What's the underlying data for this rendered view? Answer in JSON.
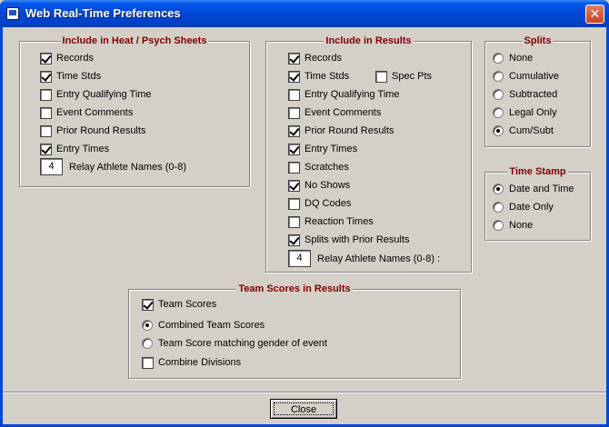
{
  "window": {
    "title": "Web Real-Time Preferences"
  },
  "heat_psych": {
    "title": "Include in Heat / Psych Sheets",
    "items": [
      {
        "label": "Records",
        "checked": true
      },
      {
        "label": "Time Stds",
        "checked": true
      },
      {
        "label": "Entry Qualifying Time",
        "checked": false
      },
      {
        "label": "Event Comments",
        "checked": false
      },
      {
        "label": "Prior Round Results",
        "checked": false
      },
      {
        "label": "Entry Times",
        "checked": true
      }
    ],
    "relay_value": "4",
    "relay_label": "Relay Athlete Names (0-8)"
  },
  "results": {
    "title": "Include in Results",
    "items": [
      {
        "label": "Records",
        "checked": true
      },
      {
        "label": "Time Stds",
        "checked": true
      },
      {
        "label": "Entry Qualifying Time",
        "checked": false
      },
      {
        "label": "Event Comments",
        "checked": false
      },
      {
        "label": "Prior Round Results",
        "checked": true
      },
      {
        "label": "Entry Times",
        "checked": true
      },
      {
        "label": "Scratches",
        "checked": false
      },
      {
        "label": "No Shows",
        "checked": true
      },
      {
        "label": "DQ Codes",
        "checked": false
      },
      {
        "label": "Reaction Times",
        "checked": false
      },
      {
        "label": "Splits with Prior Results",
        "checked": true
      }
    ],
    "spec_pts": {
      "label": "Spec Pts",
      "checked": false
    },
    "relay_value": "4",
    "relay_label": "Relay Athlete Names (0-8) :"
  },
  "splits": {
    "title": "Splits",
    "options": [
      {
        "label": "None",
        "selected": false
      },
      {
        "label": "Cumulative",
        "selected": false
      },
      {
        "label": "Subtracted",
        "selected": false
      },
      {
        "label": "Legal Only",
        "selected": false
      },
      {
        "label": "Cum/Subt",
        "selected": true
      }
    ]
  },
  "time_stamp": {
    "title": "Time Stamp",
    "options": [
      {
        "label": "Date and Time",
        "selected": true
      },
      {
        "label": "Date Only",
        "selected": false
      },
      {
        "label": "None",
        "selected": false
      }
    ]
  },
  "team_scores": {
    "title": "Team Scores in Results",
    "team_scores": {
      "label": "Team Scores",
      "checked": true
    },
    "combined": {
      "label": "Combined Team Scores",
      "selected": true
    },
    "matching": {
      "label": "Team Score matching gender of event",
      "selected": false
    },
    "combine_divisions": {
      "label": "Combine Divisions",
      "checked": false
    }
  },
  "buttons": {
    "close": "Close"
  }
}
